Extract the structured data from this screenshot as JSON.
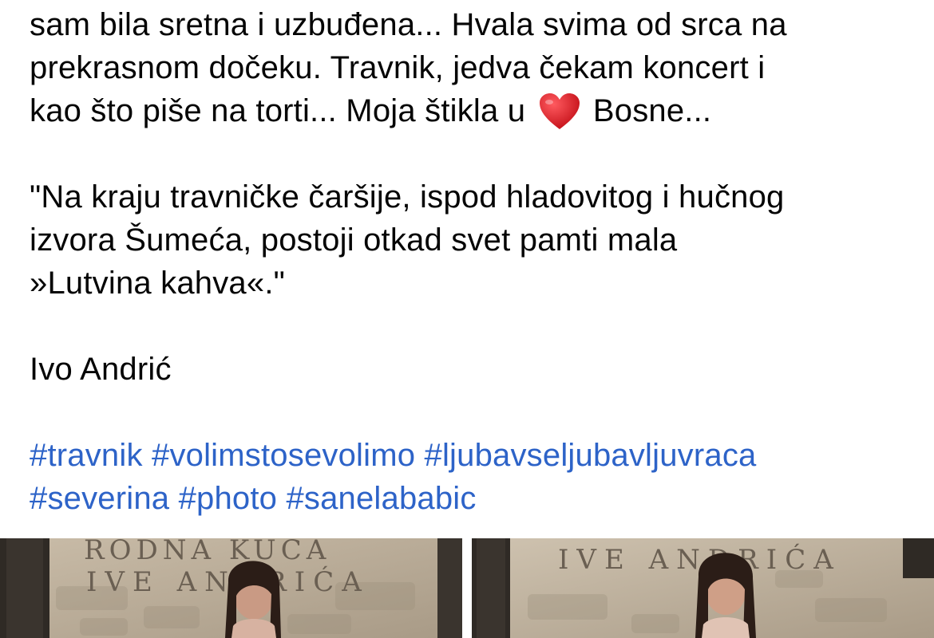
{
  "post": {
    "lines": [
      "sam bila sretna i uzbuđena... Hvala svima od srca na",
      "prekrasnom dočeku. Travnik, jedva čekam koncert i"
    ],
    "line3_before_heart": "kao što piše na torti... Moja štikla u",
    "heart_emoji": "heart-icon",
    "line3_after_heart": "Bosne...",
    "quote_lines": [
      "\"Na kraju travničke čaršije, ispod hladovitog i hučnog",
      "izvora Šumeća, postoji otkad svet pamti mala",
      "»Lutvina kahva«.\""
    ],
    "author": "Ivo Andrić",
    "hashtags_line1": [
      "#travnik",
      "#volimstosevolimo",
      "#ljubavseljubavljuvraca"
    ],
    "hashtags_line2": [
      "#severina",
      "#photo",
      "#sanelababic"
    ]
  },
  "photos": {
    "left_sign_text": [
      "RODNA KUĆA",
      "IVE ANDRIĆA"
    ],
    "right_sign_text": [
      "IVE ANDRIĆA"
    ]
  },
  "colors": {
    "text": "#050505",
    "hashtag": "#2d63c8",
    "heart": "#d8262e",
    "stone": "#b8aa96"
  }
}
